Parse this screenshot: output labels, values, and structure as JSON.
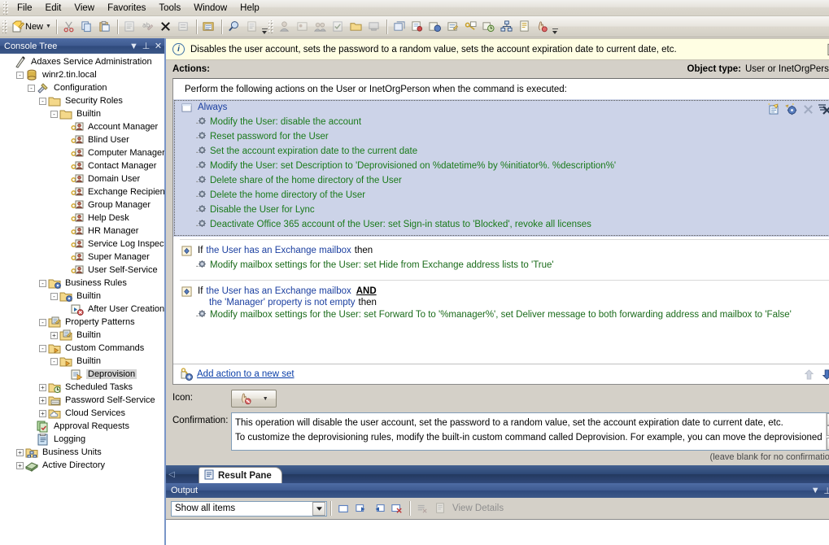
{
  "menu": {
    "items": [
      "File",
      "Edit",
      "View",
      "Favorites",
      "Tools",
      "Window",
      "Help"
    ]
  },
  "toolbar": {
    "new_label": "New",
    "icons": [
      "new-icon",
      "dropdown-arrow-icon",
      "cut-icon",
      "copy-icon",
      "paste-icon",
      "properties-icon",
      "rename-icon",
      "delete-icon",
      "refresh-icon",
      "export-list-icon",
      "find-icon",
      "report-icon",
      "overflow-icon"
    ],
    "icons_group2": [
      "new-user-icon",
      "new-contact-icon",
      "new-group-icon",
      "new-task-icon",
      "new-folder-icon",
      "new-computer-icon",
      "new-ou-icon",
      "new-business-rule-icon",
      "new-custom-command-icon",
      "new-property-pattern-icon",
      "new-security-role-icon",
      "new-scheduled-task-icon",
      "new-business-unit-icon",
      "new-report-icon",
      "deprovision-icon",
      "overflow-icon"
    ]
  },
  "tree_pane": {
    "title": "Console Tree",
    "header_buttons": [
      "chevron-down-icon",
      "pin-icon",
      "close-icon"
    ],
    "nodes": [
      {
        "label": "Adaxes Service Administration",
        "indent": 0,
        "expander": "",
        "icon": "adaxes-icon",
        "selected": false
      },
      {
        "label": "winr2.tin.local",
        "indent": 1,
        "expander": "-",
        "icon": "service-icon",
        "selected": false
      },
      {
        "label": "Configuration",
        "indent": 2,
        "expander": "-",
        "icon": "configuration-icon",
        "selected": false
      },
      {
        "label": "Security Roles",
        "indent": 3,
        "expander": "-",
        "icon": "folder-icon",
        "selected": false
      },
      {
        "label": "Builtin",
        "indent": 4,
        "expander": "-",
        "icon": "folder-icon",
        "selected": false
      },
      {
        "label": "Account Manager",
        "indent": 5,
        "expander": "",
        "icon": "security-role-icon",
        "selected": false
      },
      {
        "label": "Blind User",
        "indent": 5,
        "expander": "",
        "icon": "security-role-icon",
        "selected": false
      },
      {
        "label": "Computer Manager",
        "indent": 5,
        "expander": "",
        "icon": "security-role-icon",
        "selected": false
      },
      {
        "label": "Contact Manager",
        "indent": 5,
        "expander": "",
        "icon": "security-role-icon",
        "selected": false
      },
      {
        "label": "Domain User",
        "indent": 5,
        "expander": "",
        "icon": "security-role-icon",
        "selected": false
      },
      {
        "label": "Exchange Recipient Administrator",
        "indent": 5,
        "expander": "",
        "icon": "security-role-icon",
        "selected": false
      },
      {
        "label": "Group Manager",
        "indent": 5,
        "expander": "",
        "icon": "security-role-icon",
        "selected": false
      },
      {
        "label": "Help Desk",
        "indent": 5,
        "expander": "",
        "icon": "security-role-icon",
        "selected": false
      },
      {
        "label": "HR Manager",
        "indent": 5,
        "expander": "",
        "icon": "security-role-icon",
        "selected": false
      },
      {
        "label": "Service Log Inspector",
        "indent": 5,
        "expander": "",
        "icon": "security-role-icon",
        "selected": false
      },
      {
        "label": "Super Manager",
        "indent": 5,
        "expander": "",
        "icon": "security-role-icon",
        "selected": false
      },
      {
        "label": "User Self-Service",
        "indent": 5,
        "expander": "",
        "icon": "security-role-icon",
        "selected": false
      },
      {
        "label": "Business Rules",
        "indent": 3,
        "expander": "-",
        "icon": "business-rules-icon",
        "selected": false
      },
      {
        "label": "Builtin",
        "indent": 4,
        "expander": "-",
        "icon": "business-rules-icon",
        "selected": false
      },
      {
        "label": "After User Creation",
        "indent": 5,
        "expander": "",
        "icon": "business-rule-icon",
        "selected": false
      },
      {
        "label": "Property Patterns",
        "indent": 3,
        "expander": "-",
        "icon": "property-patterns-icon",
        "selected": false
      },
      {
        "label": "Builtin",
        "indent": 4,
        "expander": "+",
        "icon": "property-patterns-icon",
        "selected": false
      },
      {
        "label": "Custom Commands",
        "indent": 3,
        "expander": "-",
        "icon": "custom-commands-icon",
        "selected": false
      },
      {
        "label": "Builtin",
        "indent": 4,
        "expander": "-",
        "icon": "custom-commands-icon",
        "selected": false
      },
      {
        "label": "Deprovision",
        "indent": 5,
        "expander": "",
        "icon": "custom-command-icon",
        "selected": true
      },
      {
        "label": "Scheduled Tasks",
        "indent": 3,
        "expander": "+",
        "icon": "scheduled-tasks-icon",
        "selected": false
      },
      {
        "label": "Password Self-Service",
        "indent": 3,
        "expander": "+",
        "icon": "password-self-service-icon",
        "selected": false
      },
      {
        "label": "Cloud Services",
        "indent": 3,
        "expander": "+",
        "icon": "cloud-services-icon",
        "selected": false
      },
      {
        "label": "Approval Requests",
        "indent": 2,
        "expander": "",
        "icon": "approval-requests-icon",
        "selected": false
      },
      {
        "label": "Logging",
        "indent": 2,
        "expander": "",
        "icon": "logging-icon",
        "selected": false
      },
      {
        "label": "Business Units",
        "indent": 1,
        "expander": "+",
        "icon": "business-units-icon",
        "selected": false
      },
      {
        "label": "Active Directory",
        "indent": 1,
        "expander": "+",
        "icon": "active-directory-icon",
        "selected": false
      }
    ]
  },
  "info_bar": {
    "text": "Disables the user account, sets the password to a random value, sets the account expiration date to current date, etc.",
    "edit_icon": "edit-description-icon"
  },
  "actions_header": {
    "label": "Actions:",
    "object_type_label": "Object type:",
    "object_type_value": "User or InetOrgPerson"
  },
  "actions_box": {
    "intro": "Perform the following actions on the User or InetOrgPerson when the command is executed:",
    "block_tools": [
      "add-action-icon",
      "add-condition-icon",
      "remove-icon",
      "remove-all-icon"
    ],
    "sets": [
      {
        "selected": true,
        "condition_prefix": "",
        "condition": "Always",
        "condition_suffix": "",
        "condition2": "",
        "and_keyword": "",
        "icon": "always-icon",
        "actions": [
          "Modify the User: disable the account",
          "Reset password for the User",
          "Set the account expiration date to the current date",
          "Modify the User: set Description to 'Deprovisioned on %datetime% by %initiator%. %description%'",
          "Delete share of the home directory of the User",
          "Delete the home directory of the User",
          "Disable the User for Lync",
          "Deactivate Office 365 account of the User: set Sign-in status to 'Blocked', revoke all licenses"
        ]
      },
      {
        "selected": false,
        "condition_prefix": "If",
        "condition": "the User has an Exchange mailbox",
        "condition_suffix": "then",
        "condition2": "",
        "and_keyword": "",
        "icon": "condition-icon",
        "actions": [
          "Modify mailbox settings for the User: set Hide from Exchange address lists to 'True'"
        ]
      },
      {
        "selected": false,
        "condition_prefix": "If",
        "condition": "the User has an Exchange mailbox",
        "condition_suffix": "",
        "and_keyword": "AND",
        "condition2": "the 'Manager' property is not empty",
        "condition2_suffix": "then",
        "icon": "condition-icon",
        "actions": [
          "Modify mailbox settings for the User: set Forward To to '%manager%', set Deliver message to both forwarding address and mailbox to 'False'"
        ]
      }
    ],
    "add_link": "Add action to a new set",
    "move_up_icon": "move-up-icon",
    "move_down_icon": "move-down-icon"
  },
  "form": {
    "icon_label": "Icon:",
    "icon_value": "deprovision-hand-icon",
    "confirmation_label": "Confirmation:",
    "confirmation_line1": "This operation will disable the user account, set the password to a random value, set the account expiration date to current date, etc.",
    "confirmation_line2": "To customize the deprovisioning rules, modify the built-in custom command called Deprovision. For example, you can move the deprovisioned",
    "hint": "(leave blank for no confirmation)"
  },
  "bottom_tabs": {
    "left_arrow": "scroll-left-icon",
    "right_arrow": "scroll-right-icon",
    "tabs": [
      {
        "label": "Result Pane",
        "icon": "result-pane-icon",
        "active": true
      }
    ]
  },
  "output_pane": {
    "title": "Output",
    "header_buttons": [
      "chevron-down-icon",
      "pin-icon",
      "close-icon"
    ],
    "filter_value": "Show all items",
    "filter_options": [
      "Show all items"
    ],
    "toolbar_icons": [
      "clear-icon",
      "next-icon",
      "previous-icon",
      "delete-item-icon",
      "clear-all-icon",
      "details-icon"
    ],
    "view_details_label": "View Details"
  },
  "colors": {
    "accent": "#2f4a7d",
    "selection": "#ccd3e8",
    "action_text": "#1a7a1a",
    "condition_text": "#1b3fa0",
    "link": "#0b3fa8",
    "info_bg": "#fffee3"
  }
}
